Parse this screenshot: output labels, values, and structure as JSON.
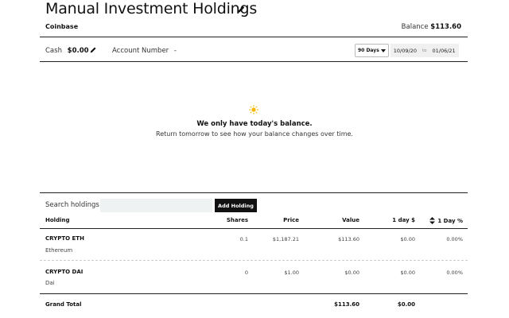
{
  "page": {
    "title": "Manual Investment Holdings"
  },
  "account": {
    "institution": "Coinbase",
    "balance_label": "Balance",
    "balance_value": "$113.60",
    "cash_label": "Cash",
    "cash_value": "$0.00",
    "account_number_label": "Account Number",
    "account_number_value": "-"
  },
  "range": {
    "selected": "90 Days",
    "start_date": "10/09/20",
    "to_label": "to",
    "end_date": "01/06/21"
  },
  "empty_state": {
    "icon": "sun-icon",
    "title": "We only have today's balance.",
    "subtitle": "Return tomorrow to see how your balance changes over time."
  },
  "holdings": {
    "search_label": "Search holdings",
    "search_placeholder": "",
    "add_button": "Add Holding",
    "columns": {
      "holding": "Holding",
      "shares": "Shares",
      "price": "Price",
      "value": "Value",
      "day_dollar": "1 day $",
      "day_pct": "1 Day %"
    },
    "rows": [
      {
        "symbol": "CRYPTO ETH",
        "name": "Ethereum",
        "shares": "0.1",
        "price": "$1,187.21",
        "value": "$113.60",
        "day_dollar": "$0.00",
        "day_pct": "0.00%"
      },
      {
        "symbol": "CRYPTO DAI",
        "name": "Dai",
        "shares": "0",
        "price": "$1.00",
        "value": "$0.00",
        "day_dollar": "$0.00",
        "day_pct": "0.00%"
      }
    ],
    "total": {
      "label": "Grand Total",
      "value": "$113.60",
      "day_dollar": "$0.00"
    }
  },
  "colors": {
    "accent": "#111111",
    "sun": "#f5b800",
    "search_bg": "#eef2f3"
  }
}
